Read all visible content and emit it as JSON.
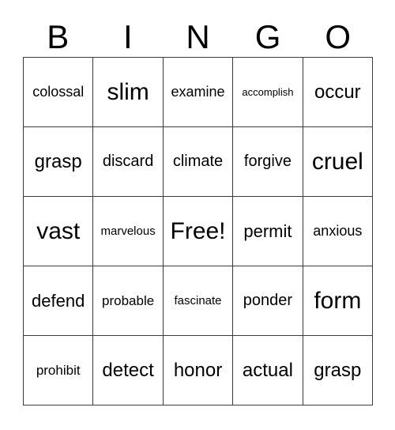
{
  "card": {
    "header_letters": [
      "B",
      "I",
      "N",
      "G",
      "O"
    ],
    "rows": [
      [
        {
          "text": "colossal",
          "size": "fs-m"
        },
        {
          "text": "slim",
          "size": "fs-xxl"
        },
        {
          "text": "examine",
          "size": "fs-m"
        },
        {
          "text": "accomplish",
          "size": "fs-xs"
        },
        {
          "text": "occur",
          "size": "fs-xl"
        }
      ],
      [
        {
          "text": "grasp",
          "size": "fs-xl"
        },
        {
          "text": "discard",
          "size": "fs-ml"
        },
        {
          "text": "climate",
          "size": "fs-ml"
        },
        {
          "text": "forgive",
          "size": "fs-ml"
        },
        {
          "text": "cruel",
          "size": "fs-xxl"
        }
      ],
      [
        {
          "text": "vast",
          "size": "fs-xxl"
        },
        {
          "text": "marvelous",
          "size": "fs-s"
        },
        {
          "text": "Free!",
          "size": "fs-xxl"
        },
        {
          "text": "permit",
          "size": "fs-l"
        },
        {
          "text": "anxious",
          "size": "fs-m"
        }
      ],
      [
        {
          "text": "defend",
          "size": "fs-l"
        },
        {
          "text": "probable",
          "size": "fs-sm"
        },
        {
          "text": "fascinate",
          "size": "fs-s"
        },
        {
          "text": "ponder",
          "size": "fs-ml"
        },
        {
          "text": "form",
          "size": "fs-xxl"
        }
      ],
      [
        {
          "text": "prohibit",
          "size": "fs-sm"
        },
        {
          "text": "detect",
          "size": "fs-xl"
        },
        {
          "text": "honor",
          "size": "fs-xl"
        },
        {
          "text": "actual",
          "size": "fs-xl"
        },
        {
          "text": "grasp",
          "size": "fs-xl"
        }
      ]
    ],
    "colors": {
      "grid_line": "#3a3a3a",
      "text": "#000000",
      "background": "#ffffff"
    }
  }
}
